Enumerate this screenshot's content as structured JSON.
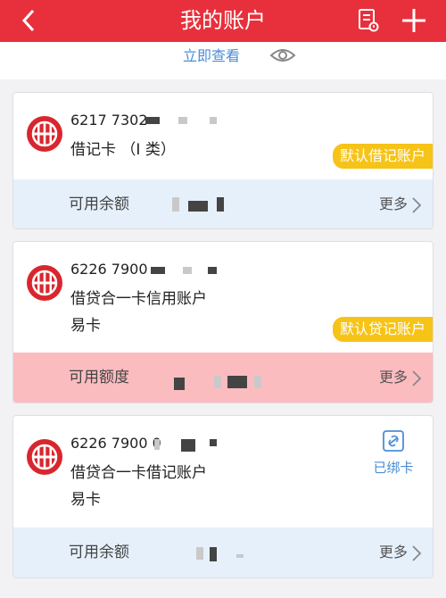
{
  "header": {
    "title": "我的账户",
    "back_icon": "back-chevron-icon",
    "doc_icon": "document-icon",
    "add_icon": "plus-icon"
  },
  "subbar": {
    "view_label": "立即查看",
    "eye_icon": "eye-icon"
  },
  "cards": [
    {
      "number": "6217 7302",
      "name": "借记卡 （I 类）",
      "badge": "默认借记账户",
      "bottom_label": "可用余额",
      "more": "更多"
    },
    {
      "number": "6226 7900",
      "name": "借贷合一卡信用账户",
      "name2": "易卡",
      "badge": "默认贷记账户",
      "bottom_label": "可用额度",
      "more": "更多"
    },
    {
      "number": "6226 7900 0",
      "name": "借贷合一卡借记账户",
      "name2": "易卡",
      "linked": "已绑卡",
      "bottom_label": "可用余额",
      "more": "更多"
    }
  ],
  "colors": {
    "brand": "#e8303c",
    "badge": "#f6c317",
    "link": "#4a8ed6",
    "blue_strip": "#e5f0fb",
    "pink_strip": "#fbbcc0"
  }
}
